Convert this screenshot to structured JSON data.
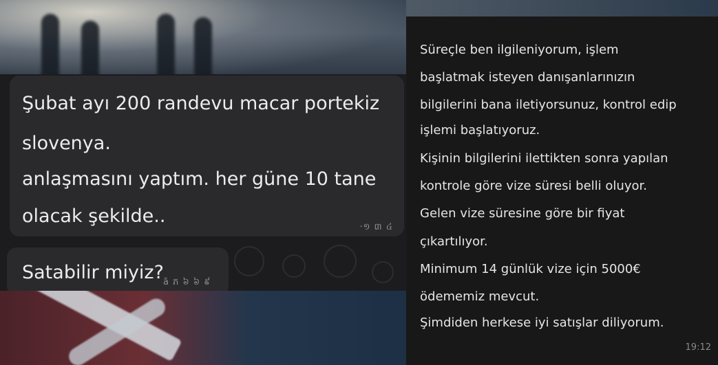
{
  "left_chat": {
    "message_1": {
      "lines": [
        "Şubat ayı 200 randevu macar portekiz",
        "slovenya.",
        "anlaşmasını yaptım. her güne 10 tane",
        "olacak şekilde.."
      ],
      "time": "·១ ៣ ៤"
    },
    "message_2": {
      "text": "Satabilir miyiz?",
      "time": "ā ភ ៦ ៦ ៩"
    }
  },
  "right_chat": {
    "lines": [
      "Süreçle ben ilgileniyorum, işlem",
      "başlatmak isteyen danışanlarınızın",
      "bilgilerini bana iletiyorsunuz, kontrol edip",
      "işlemi başlatıyoruz.",
      "Kişinin bilgilerini ilettikten sonra yapılan",
      "kontrole göre vize süresi belli oluyor.",
      "Gelen vize süresine göre bir fiyat",
      "çıkartılıyor.",
      "Minimum 14 günlük  vize için 5000€",
      "ödememiz mevcut.",
      "Şimdiden herkese iyi satışlar diliyorum."
    ],
    "time": "19:12"
  },
  "colors": {
    "left_panel_bg": "#1c1c1e",
    "bubble_bg": "#2a2a2c",
    "right_panel_bg": "#181818",
    "text": "#ececec",
    "timestamp": "#8f8f93"
  }
}
